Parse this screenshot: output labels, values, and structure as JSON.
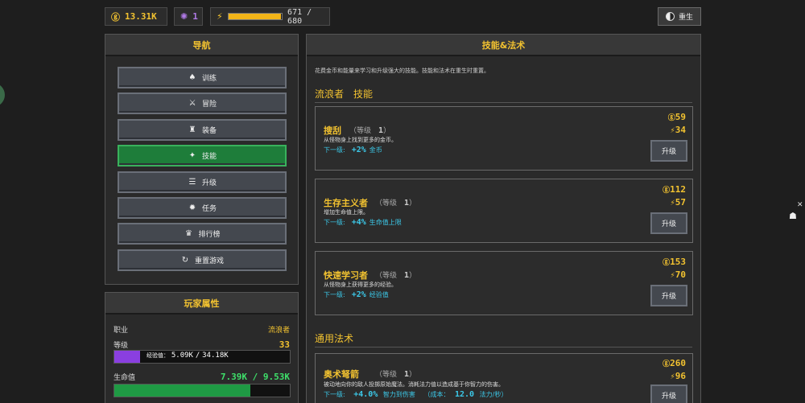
{
  "topbar": {
    "gold": "13.31K",
    "gems": "1",
    "energy_current": "671",
    "energy_sep": "/",
    "energy_max": "680",
    "energy_fraction": 0.987,
    "rebirth_label": "重生"
  },
  "nav": {
    "title": "导航",
    "items": [
      {
        "label": "训练",
        "icon": "dumbbell-icon"
      },
      {
        "label": "冒险",
        "icon": "crossed-swords-icon"
      },
      {
        "label": "装备",
        "icon": "armor-icon"
      },
      {
        "label": "技能",
        "icon": "skill-icon"
      },
      {
        "label": "升级",
        "icon": "wifi-icon"
      },
      {
        "label": "任务",
        "icon": "gear-icon"
      },
      {
        "label": "排行榜",
        "icon": "trophy-icon"
      },
      {
        "label": "重置游戏",
        "icon": "reset-icon"
      }
    ],
    "active_index": 3
  },
  "player": {
    "title": "玩家属性",
    "class_label": "职业",
    "class_value": "流浪者",
    "level_label": "等级",
    "level_value": "33",
    "xp_label": "经验值：",
    "xp_current": "5.09K",
    "xp_sep": "/",
    "xp_max": "34.18K",
    "xp_fraction": 0.149,
    "hp_label": "生命值",
    "hp_current": "7.39K",
    "hp_sep": "/",
    "hp_max": "9.53K",
    "hp_fraction": 0.775
  },
  "main": {
    "title": "技能&法术",
    "intro": "花费金币和能量来学习和升级强大的技能。技能和法术在重生时重置。",
    "class_section": "流浪者　技能",
    "general_section": "通用法术",
    "level_word": "等级",
    "next_label": "下一级:",
    "upgrade_label": "升级",
    "skills": [
      {
        "name": "搜刮",
        "level": "1",
        "desc": "从怪物身上找到更多的金币。",
        "next_value": "+2%",
        "next_stat": "金币",
        "cost_gold": "59",
        "cost_energy": "34"
      },
      {
        "name": "生存主义者",
        "level": "1",
        "desc": "增加生命值上限。",
        "next_value": "+4%",
        "next_stat": "生命值上限",
        "cost_gold": "112",
        "cost_energy": "57"
      },
      {
        "name": "快速学习者",
        "level": "1",
        "desc": "从怪物身上获得更多的经验。",
        "next_value": "+2%",
        "next_stat": "经验值",
        "cost_gold": "153",
        "cost_energy": "70"
      }
    ],
    "spell": {
      "name": "奥术弩箭",
      "level": "1",
      "desc": "被动地向你的敌人投掷原始魔法。消耗法力值以造成基于你智力的伤害。",
      "next_value": "+4.0%",
      "next_stat": "智力到伤害",
      "cost_label": "（成本：",
      "cost_value": "12.0",
      "cost_unit": "法力/秒）",
      "cost_gold": "260",
      "cost_energy": "96"
    }
  }
}
